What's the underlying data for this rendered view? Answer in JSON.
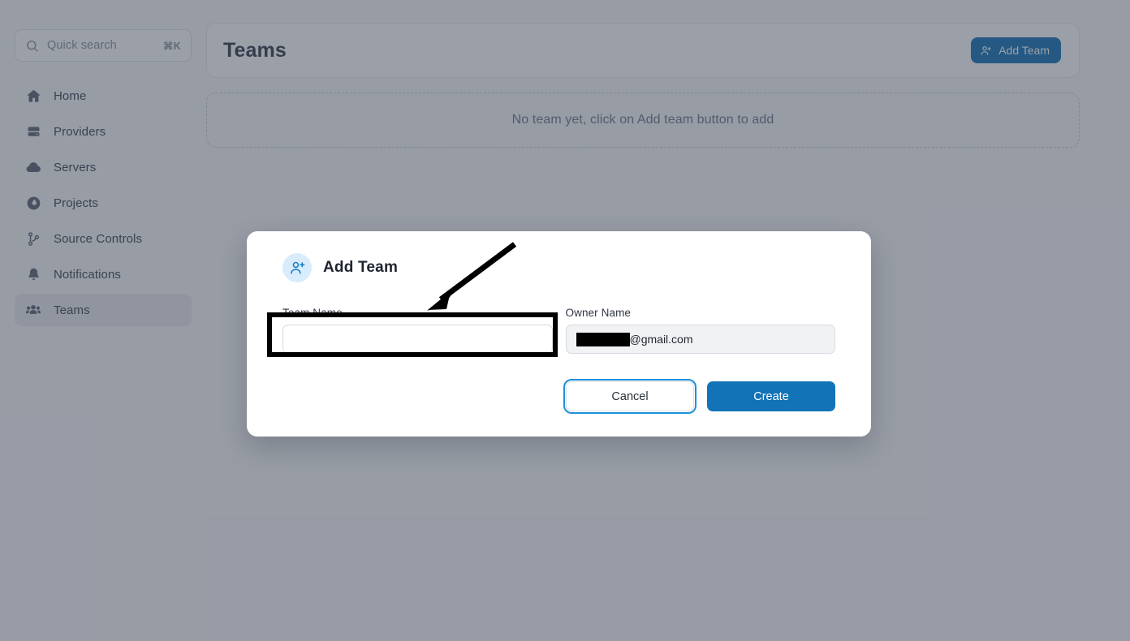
{
  "sidebar": {
    "search": {
      "placeholder": "Quick search",
      "shortcut": "⌘K",
      "icon": "search-icon"
    },
    "items": [
      {
        "label": "Home",
        "icon": "home-icon",
        "active": false
      },
      {
        "label": "Providers",
        "icon": "server-rack-icon",
        "active": false
      },
      {
        "label": "Servers",
        "icon": "cloud-icon",
        "active": false
      },
      {
        "label": "Projects",
        "icon": "flame-icon",
        "active": false
      },
      {
        "label": "Source Controls",
        "icon": "git-branch-icon",
        "active": false
      },
      {
        "label": "Notifications",
        "icon": "bell-icon",
        "active": false
      },
      {
        "label": "Teams",
        "icon": "users-icon",
        "active": true
      }
    ]
  },
  "main": {
    "title": "Teams",
    "add_team_label": "Add Team",
    "add_team_icon": "user-plus-icon",
    "empty_state": "No team yet, click on Add team button to add"
  },
  "modal": {
    "title": "Add Team",
    "icon": "user-plus-icon",
    "fields": {
      "team_name": {
        "label": "Team Name",
        "value": "",
        "placeholder": ""
      },
      "owner_name": {
        "label": "Owner Name",
        "value": "@gmail.com",
        "redacted": true
      }
    },
    "buttons": {
      "cancel": "Cancel",
      "create": "Create"
    }
  },
  "colors": {
    "accent": "#1273b6",
    "focus_ring": "#1e90d8",
    "icon_badge_bg": "#d9ecfb",
    "overlay": "#878c99",
    "sidebar_active_bg": "#e9ebf0",
    "annotation": "#000000"
  },
  "annotations": {
    "highlight_target": "team-name-input",
    "arrow": "points-to-team-name-input"
  }
}
